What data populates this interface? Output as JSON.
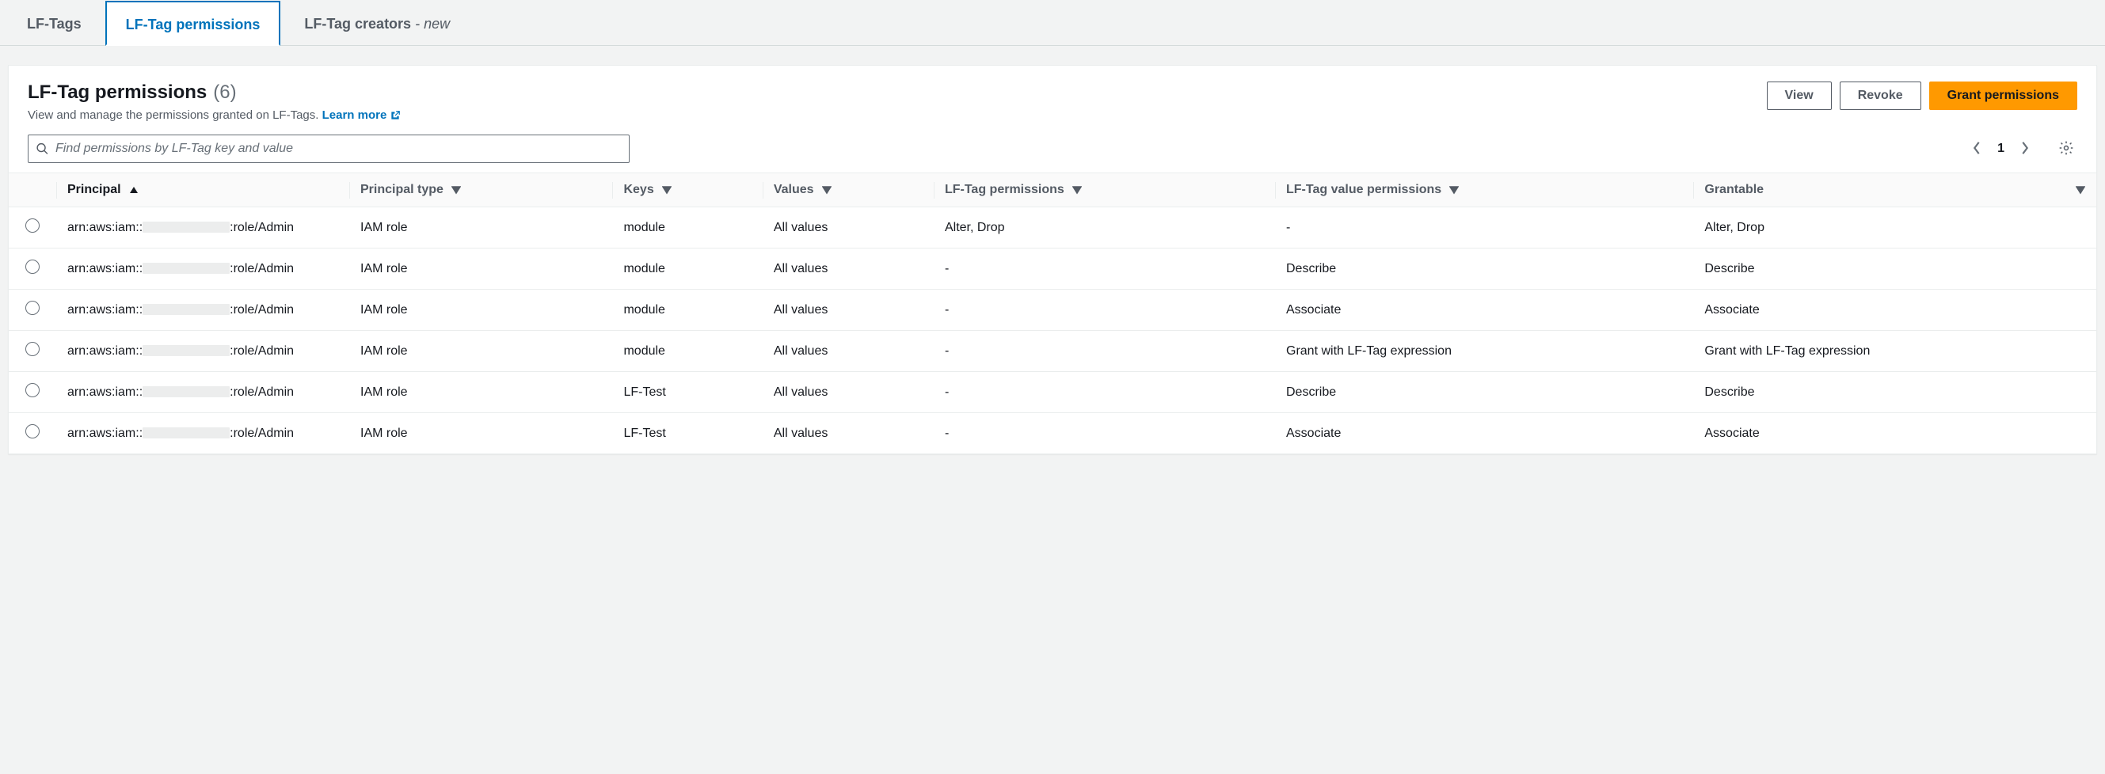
{
  "tabs": {
    "lftags": "LF-Tags",
    "permissions": "LF-Tag permissions",
    "creators": "LF-Tag creators",
    "creators_badge": "- new"
  },
  "header": {
    "title": "LF-Tag permissions",
    "count": "(6)",
    "subtitle": "View and manage the permissions granted on LF-Tags.",
    "learn_more": "Learn more"
  },
  "actions": {
    "view": "View",
    "revoke": "Revoke",
    "grant": "Grant permissions"
  },
  "search": {
    "placeholder": "Find permissions by LF-Tag key and value"
  },
  "pagination": {
    "page": "1"
  },
  "columns": {
    "principal": "Principal",
    "principal_type": "Principal type",
    "keys": "Keys",
    "values": "Values",
    "lftag_perms": "LF-Tag permissions",
    "lftag_value_perms": "LF-Tag value permissions",
    "grantable": "Grantable"
  },
  "rows": [
    {
      "principal_prefix": "arn:aws:iam::",
      "principal_suffix": ":role/Admin",
      "principal_type": "IAM role",
      "keys": "module",
      "values": "All values",
      "lftag_perms": "Alter, Drop",
      "lftag_value_perms": "-",
      "grantable": "Alter, Drop"
    },
    {
      "principal_prefix": "arn:aws:iam::",
      "principal_suffix": ":role/Admin",
      "principal_type": "IAM role",
      "keys": "module",
      "values": "All values",
      "lftag_perms": "-",
      "lftag_value_perms": "Describe",
      "grantable": "Describe"
    },
    {
      "principal_prefix": "arn:aws:iam::",
      "principal_suffix": ":role/Admin",
      "principal_type": "IAM role",
      "keys": "module",
      "values": "All values",
      "lftag_perms": "-",
      "lftag_value_perms": "Associate",
      "grantable": "Associate"
    },
    {
      "principal_prefix": "arn:aws:iam::",
      "principal_suffix": ":role/Admin",
      "principal_type": "IAM role",
      "keys": "module",
      "values": "All values",
      "lftag_perms": "-",
      "lftag_value_perms": "Grant with LF-Tag expression",
      "grantable": "Grant with LF-Tag expression"
    },
    {
      "principal_prefix": "arn:aws:iam::",
      "principal_suffix": ":role/Admin",
      "principal_type": "IAM role",
      "keys": "LF-Test",
      "values": "All values",
      "lftag_perms": "-",
      "lftag_value_perms": "Describe",
      "grantable": "Describe"
    },
    {
      "principal_prefix": "arn:aws:iam::",
      "principal_suffix": ":role/Admin",
      "principal_type": "IAM role",
      "keys": "LF-Test",
      "values": "All values",
      "lftag_perms": "-",
      "lftag_value_perms": "Associate",
      "grantable": "Associate"
    }
  ]
}
